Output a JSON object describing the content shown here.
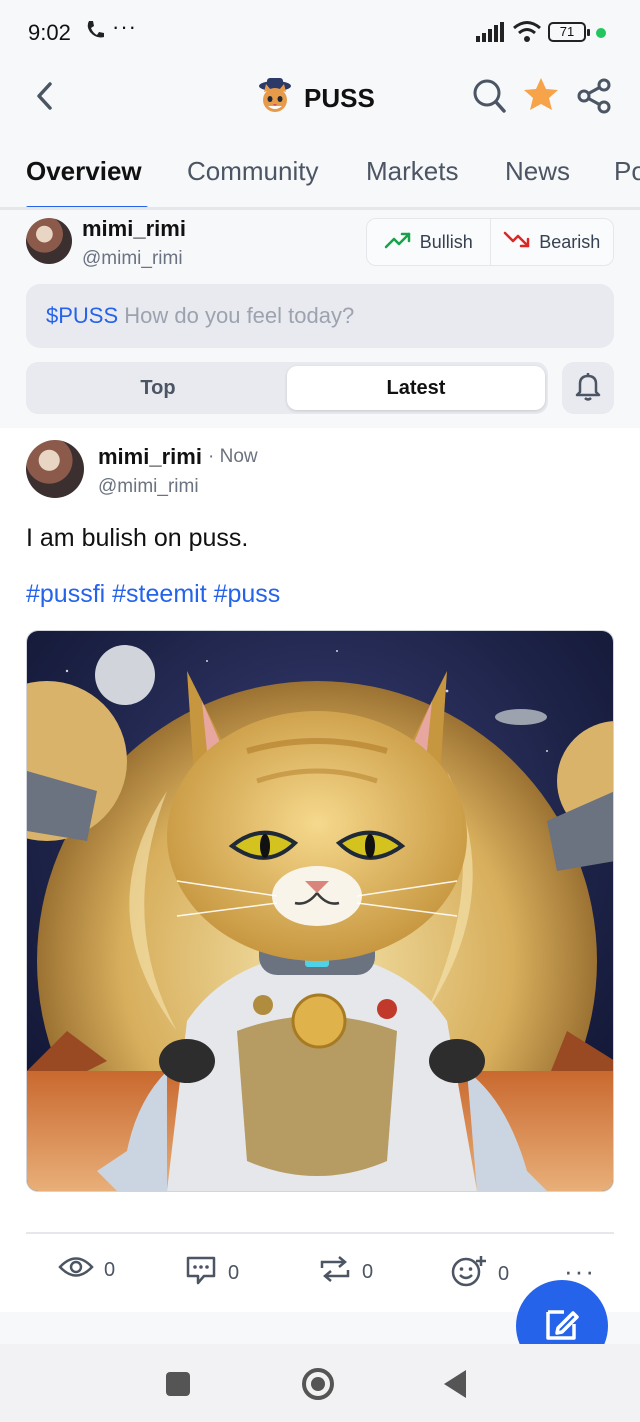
{
  "status_bar": {
    "time": "9:02",
    "battery": "71"
  },
  "header": {
    "title": "PUSS"
  },
  "tabs": [
    {
      "label": "Overview"
    },
    {
      "label": "Community"
    },
    {
      "label": "Markets"
    },
    {
      "label": "News"
    },
    {
      "label": "Po"
    }
  ],
  "composer": {
    "username": "mimi_rimi",
    "handle": "@mimi_rimi",
    "bullish_label": "Bullish",
    "bearish_label": "Bearish",
    "ticker": "$PUSS",
    "placeholder": "How do you feel today?",
    "sort_top": "Top",
    "sort_latest": "Latest",
    "selected_sort": "Latest"
  },
  "post": {
    "username": "mimi_rimi",
    "time": "· Now",
    "handle": "@mimi_rimi",
    "text": "I am bulish on puss.",
    "hashtags": "#pussfi #steemit #puss",
    "views": "0",
    "comments": "0",
    "reposts": "0",
    "reactions": "0"
  },
  "colors": {
    "accent": "#2563eb",
    "bullish": "#16a34a",
    "bearish": "#dc2626",
    "star": "#f59e0b"
  }
}
